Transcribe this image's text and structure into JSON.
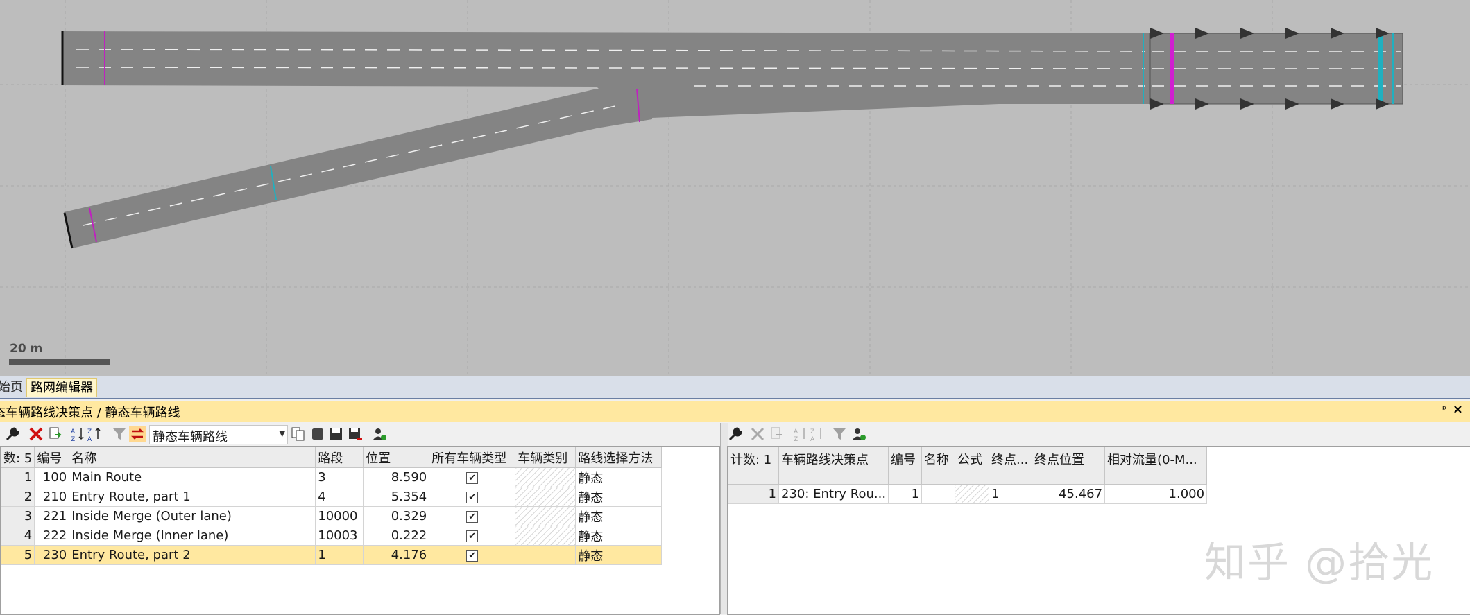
{
  "map": {
    "scale_label": "20 m"
  },
  "tabs": [
    {
      "label": "始页"
    },
    {
      "label": "路网编辑器"
    }
  ],
  "pane": {
    "title": "态车辆路线决策点 / 静态车辆路线",
    "pin": "ᵖ",
    "close": "×"
  },
  "left_toolbar": {
    "combo_value": "静态车辆路线"
  },
  "left_table": {
    "columns": [
      "数: 5",
      "编号",
      "名称",
      "路段",
      "位置",
      "所有车辆类型",
      "车辆类别",
      "路线选择方法"
    ],
    "rows": [
      {
        "idx": "1",
        "no": "100",
        "name": "Main Route",
        "link": "3",
        "pos": "8.590",
        "all_types": true,
        "method": "静态"
      },
      {
        "idx": "2",
        "no": "210",
        "name": "Entry Route, part 1",
        "link": "4",
        "pos": "5.354",
        "all_types": true,
        "method": "静态"
      },
      {
        "idx": "3",
        "no": "221",
        "name": "Inside Merge (Outer lane)",
        "link": "10000",
        "pos": "0.329",
        "all_types": true,
        "method": "静态"
      },
      {
        "idx": "4",
        "no": "222",
        "name": "Inside Merge (Inner lane)",
        "link": "10003",
        "pos": "0.222",
        "all_types": true,
        "method": "静态"
      },
      {
        "idx": "5",
        "no": "230",
        "name": "Entry Route, part 2",
        "link": "1",
        "pos": "4.176",
        "all_types": true,
        "method": "静态"
      }
    ]
  },
  "right_table": {
    "columns": [
      "计数: 1",
      "车辆路线决策点",
      "编号",
      "名称",
      "公式",
      "终点...",
      "终点位置",
      "相对流量(0-M..."
    ],
    "rows": [
      {
        "idx": "1",
        "decision": "230: Entry Rou...",
        "no": "1",
        "name": "",
        "dest": "1",
        "dest_pos": "45.467",
        "rel_flow": "1.000"
      }
    ]
  },
  "watermark": "知乎 @拾光",
  "colors": {
    "road": "#848484",
    "canvas_bg": "#bdbdbd",
    "decision_marker": "#c020c0",
    "destination_marker": "#20b0c0",
    "selected_row": "#ffe8a0"
  }
}
